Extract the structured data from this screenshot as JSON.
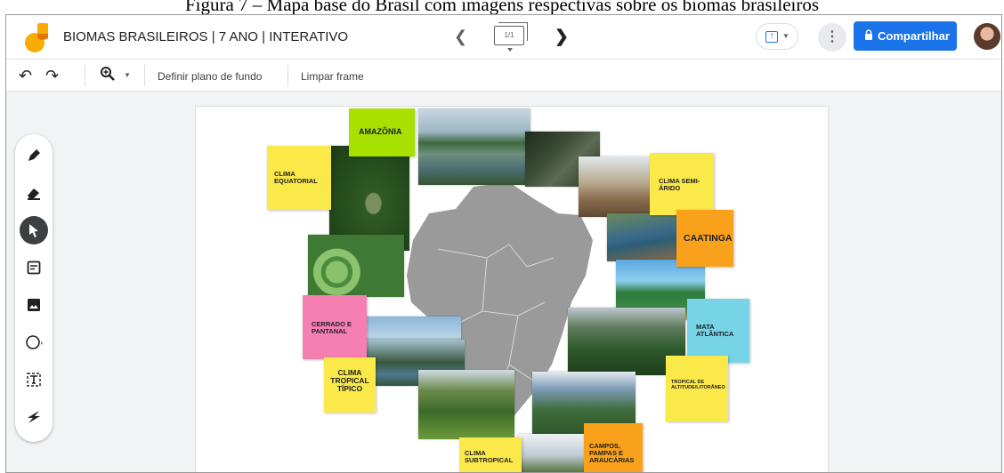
{
  "caption": "Figura 7 – Mapa base do Brasil com imagens respectivas sobre os biomas brasileiros",
  "app": {
    "title": "BIOMAS BRASILEIROS | 7 ANO | INTERATIVO",
    "frame_counter": "1/1",
    "share_label": "Compartilhar"
  },
  "toolbar": {
    "set_background": "Definir plano de fundo",
    "clear_frame": "Limpar frame"
  },
  "notes": {
    "amazonia": "AMAZÔNIA",
    "clima_equatorial": "CLIMA EQUATORIAL",
    "clima_semiarido": "CLIMA SEMI-ÁRIDO",
    "caatinga": "CAATINGA",
    "cerrado_pantanal": "CERRADO E PANTANAL",
    "mata_atlantica": "MATA ATLÂNTICA",
    "clima_tropical_tipico": "CLIMA TROPICAL TÍPICO",
    "tropical_altitude": "TROPICAL DE ALTITUDE/LITORÂNEO",
    "clima_subtropical": "CLIMA SUBTROPICAL",
    "campos_pampas": "CAMPOS, PAMPAS E ARAUCÁRIAS"
  },
  "colors": {
    "accent": "#1a73e8",
    "note_green": "#a8e100",
    "note_yellow": "#fbe94a",
    "note_orange": "#f9a11b",
    "note_pink": "#f57fb0",
    "note_cyan": "#76d4e6",
    "map_gray": "#9a9a9a"
  },
  "icons": {
    "logo": "jamboard-logo",
    "prev": "chevron-left-icon",
    "next": "chevron-right-icon",
    "upload": "upload-icon",
    "more": "more-vert-icon",
    "lock": "lock-icon",
    "undo": "undo-icon",
    "redo": "redo-icon",
    "zoom": "zoom-in-icon",
    "pen": "pen-icon",
    "eraser": "eraser-icon",
    "select": "select-arrow-icon",
    "sticky": "sticky-note-icon",
    "image": "image-icon",
    "circle": "circle-shape-icon",
    "textbox": "textbox-icon",
    "laser": "laser-icon"
  }
}
